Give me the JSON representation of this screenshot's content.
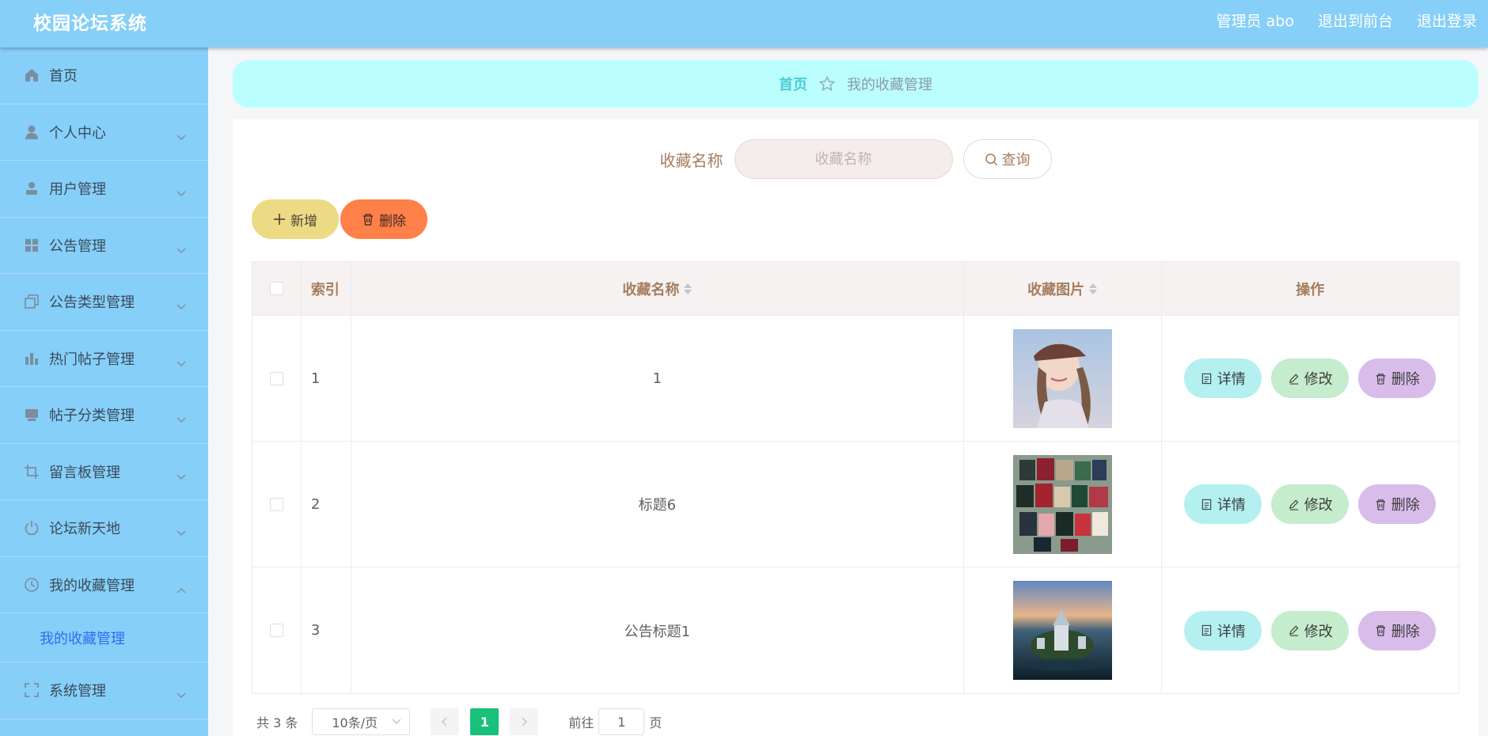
{
  "header": {
    "app_title": "校园论坛系统",
    "links": [
      "管理员 abo",
      "退出到前台",
      "退出登录"
    ]
  },
  "sidebar": {
    "items": [
      {
        "label": "首页",
        "icon": "home-icon"
      },
      {
        "label": "个人中心",
        "icon": "user-icon"
      },
      {
        "label": "用户管理",
        "icon": "user-manage-icon"
      },
      {
        "label": "公告管理",
        "icon": "grid-icon"
      },
      {
        "label": "公告类型管理",
        "icon": "copy-icon"
      },
      {
        "label": "热门帖子管理",
        "icon": "bar-chart-icon"
      },
      {
        "label": "帖子分类管理",
        "icon": "monitor-icon"
      },
      {
        "label": "留言板管理",
        "icon": "crop-icon"
      },
      {
        "label": "论坛新天地",
        "icon": "power-icon"
      },
      {
        "label": "我的收藏管理",
        "icon": "clock-icon"
      }
    ],
    "active_submenu": "我的收藏管理",
    "last_item": {
      "label": "系统管理",
      "icon": "fullscreen-icon"
    }
  },
  "breadcrumb": {
    "home": "首页",
    "current": "我的收藏管理"
  },
  "search": {
    "label": "收藏名称",
    "placeholder": "收藏名称",
    "button": "查询"
  },
  "actions": {
    "add": "新增",
    "delete": "删除"
  },
  "table": {
    "columns": [
      "索引",
      "收藏名称",
      "收藏图片",
      "操作"
    ],
    "rows": [
      {
        "index": "1",
        "name": "1",
        "image": "girl-with-cap-photo"
      },
      {
        "index": "2",
        "name": "标题6",
        "image": "certificates-photo"
      },
      {
        "index": "3",
        "name": "公告标题1",
        "image": "aerial-castle-photo"
      }
    ],
    "row_actions": {
      "detail": "详情",
      "edit": "修改",
      "remove": "删除"
    }
  },
  "pagination": {
    "total": "共 3 条",
    "page_size": "10条/页",
    "current_page": "1",
    "goto_label": "前往",
    "goto_value": "1",
    "unit": "页"
  },
  "colors": {
    "header": "#86cff8",
    "sidebar": "#86cff8",
    "breadcrumb_bg": "#bbfefe",
    "add_button": "#ecda84",
    "delete_button": "#ff8048",
    "detail_button": "#b4f0f0",
    "edit_button": "#c4eccd",
    "remove_button": "#d8bdeb",
    "active_page": "#19c17b"
  }
}
